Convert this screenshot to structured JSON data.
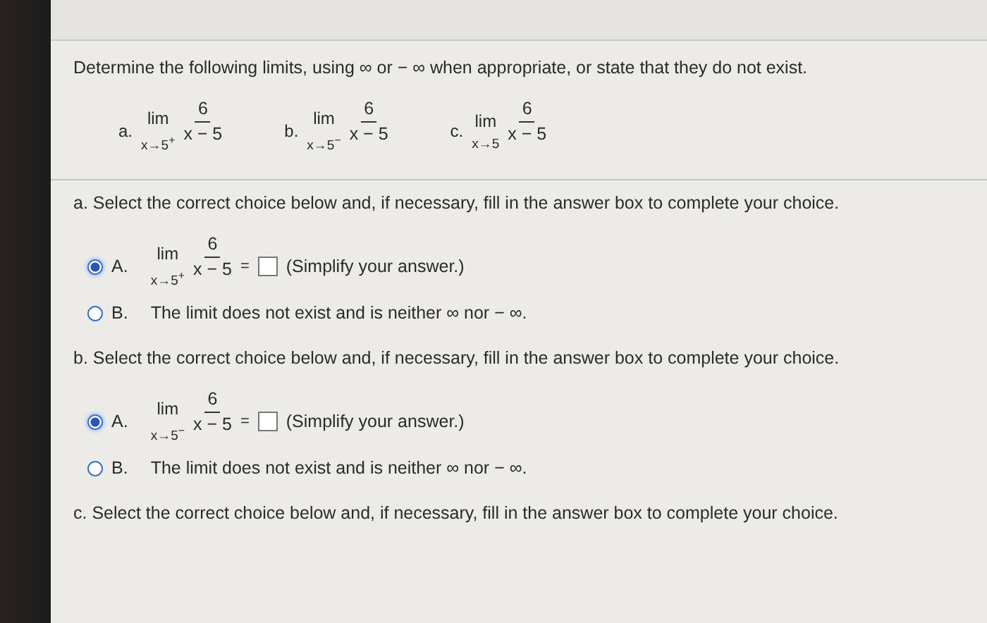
{
  "instructions": "Determine the following limits, using ∞ or − ∞ when appropriate, or state that they do not exist.",
  "problems": [
    {
      "label": "a.",
      "lim": "lim",
      "approach": "x→5$^{+}$",
      "numerator": "6",
      "denominator": "x − 5"
    },
    {
      "label": "b.",
      "lim": "lim",
      "approach": "x→5$^{−}$",
      "numerator": "6",
      "denominator": "x − 5"
    },
    {
      "label": "c.",
      "lim": "lim",
      "approach": "x→5",
      "numerator": "6",
      "denominator": "x − 5"
    }
  ],
  "parts": [
    {
      "prompt": "a. Select the correct choice below and, if necessary, fill in the answer box to complete your choice.",
      "choices": [
        {
          "kind": "limit",
          "letter": "A.",
          "selected": true,
          "lim": "lim",
          "approach": "x→5$^{+}$",
          "numerator": "6",
          "denominator": "x − 5",
          "equals": "=",
          "hint": "(Simplify your answer.)"
        },
        {
          "kind": "text",
          "letter": "B.",
          "selected": false,
          "text": "The limit does not exist and is neither ∞ nor − ∞."
        }
      ]
    },
    {
      "prompt": "b. Select the correct choice below and, if necessary, fill in the answer box to complete your choice.",
      "choices": [
        {
          "kind": "limit",
          "letter": "A.",
          "selected": true,
          "lim": "lim",
          "approach": "x→5$^{−}$",
          "numerator": "6",
          "denominator": "x − 5",
          "equals": "=",
          "hint": "(Simplify your answer.)"
        },
        {
          "kind": "text",
          "letter": "B.",
          "selected": false,
          "text": "The limit does not exist and is neither ∞ nor − ∞."
        }
      ]
    },
    {
      "prompt": "c. Select the correct choice below and, if necessary, fill in the answer box to complete your choice."
    }
  ]
}
